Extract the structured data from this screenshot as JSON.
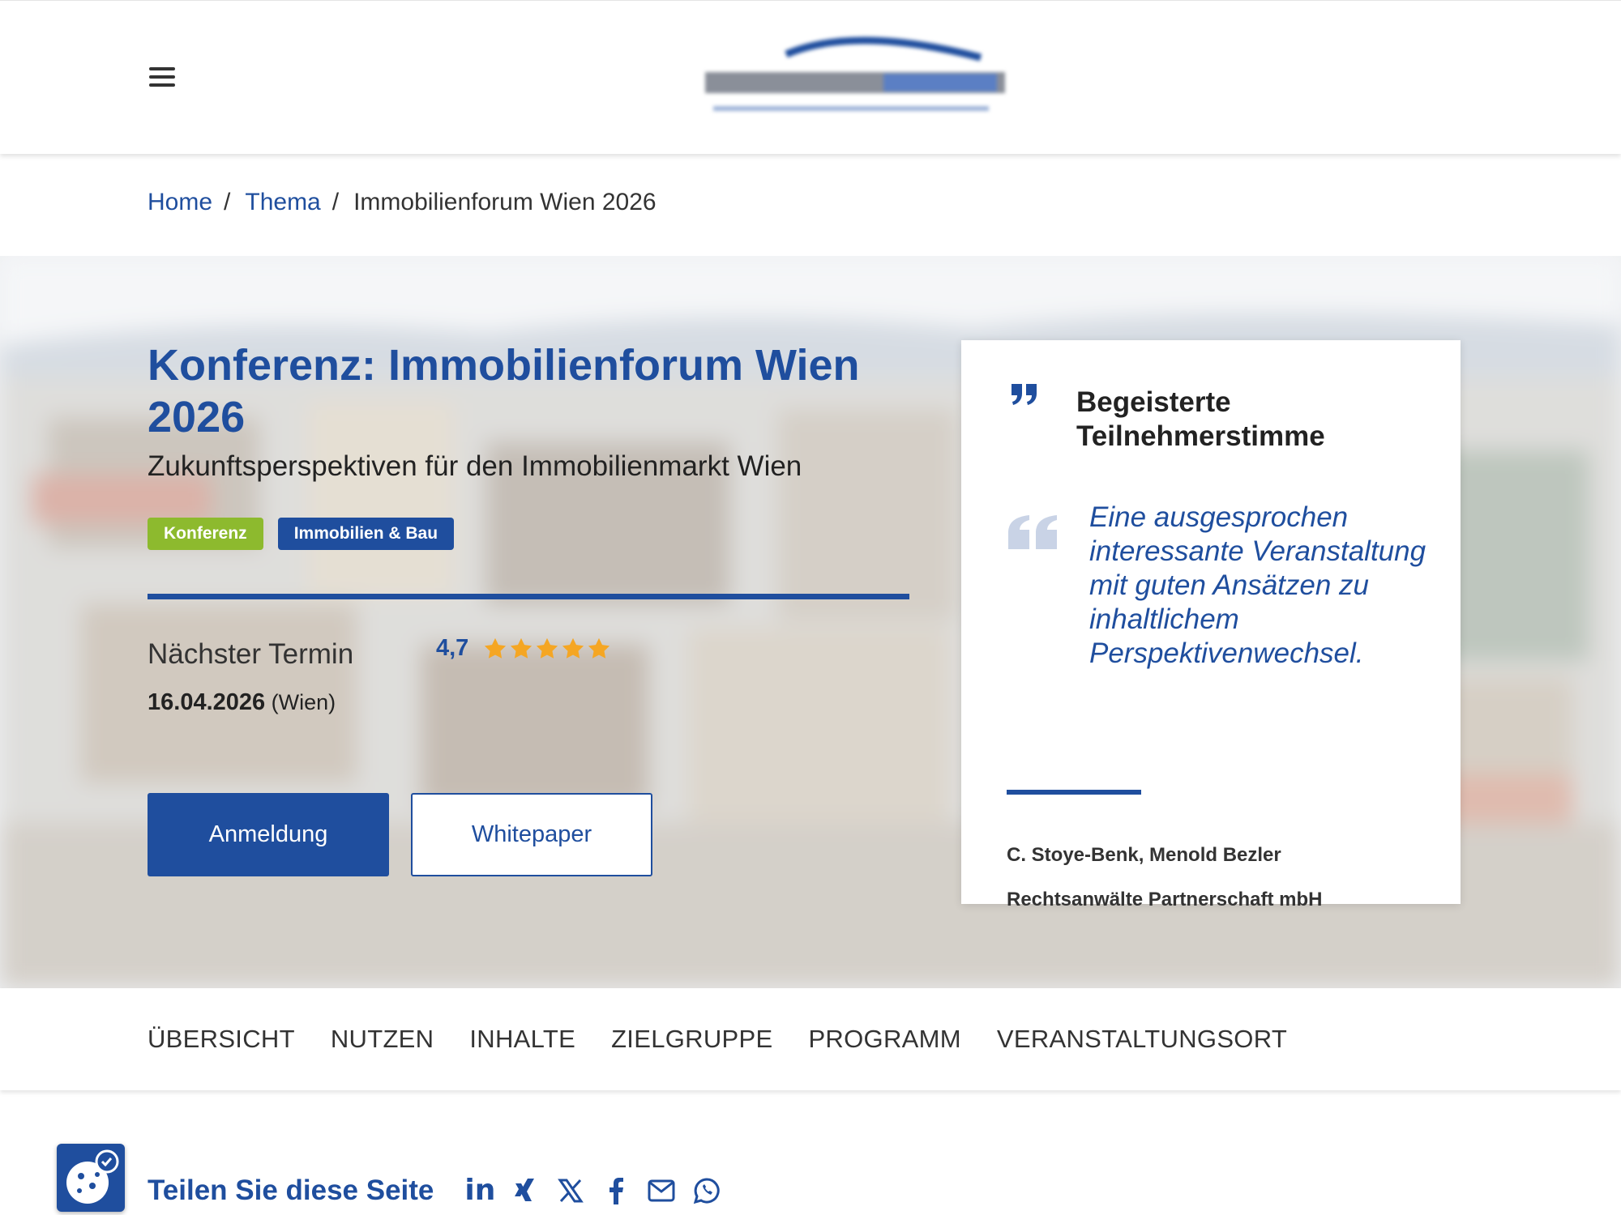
{
  "header": {
    "menu_icon": "hamburger-icon",
    "logo": "company-logo"
  },
  "breadcrumb": {
    "items": [
      "Home",
      "Thema"
    ],
    "current": "Immobilienforum Wien 2026",
    "separator": "/"
  },
  "hero": {
    "title": "Konferenz: Immobilienforum Wien 2026",
    "subtitle": "Zukunftsperspektiven für den Immobilienmarkt Wien",
    "tags": [
      "Konferenz",
      "Immobilien & Bau"
    ],
    "next_label": "Nächster Termin",
    "rating_value": "4,7",
    "rating_stars": 5,
    "date": "16.04.2026",
    "location": "(Wien)",
    "primary_button": "Anmeldung",
    "secondary_button": "Whitepaper"
  },
  "testimonial": {
    "heading": "Begeisterte Teilnehmerstimme",
    "quote": "Eine ausgesprochen interessante Veranstaltung mit guten Ansätzen zu inhaltlichem Perspektivenwechsel.",
    "author_line1": "C. Stoye-Benk, Menold Bezler",
    "author_line2": "Rechtsanwälte Partnerschaft mbH"
  },
  "section_nav": [
    "ÜBERSICHT",
    "NUTZEN",
    "INHALTE",
    "ZIELGRUPPE",
    "PROGRAMM",
    "VERANSTALTUNGSORT"
  ],
  "share": {
    "title": "Teilen Sie diese Seite",
    "linkedin_label": "in",
    "icons": [
      "linkedin-icon",
      "xing-icon",
      "x-twitter-icon",
      "facebook-icon",
      "email-icon",
      "whatsapp-icon"
    ]
  },
  "colors": {
    "primary": "#1f4e9e",
    "tag_green": "#8dba2e",
    "star": "#f5a623"
  }
}
